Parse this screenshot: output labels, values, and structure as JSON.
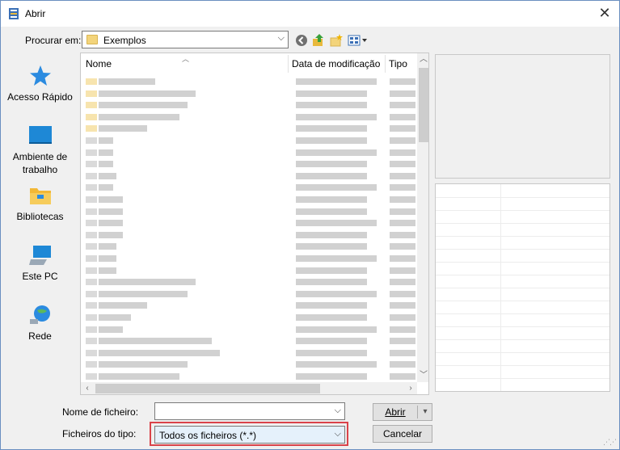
{
  "window": {
    "title": "Abrir"
  },
  "lookin": {
    "label": "Procurar em:",
    "folder": "Exemplos"
  },
  "places": [
    {
      "label": "Acesso Rápido",
      "icon": "star-icon"
    },
    {
      "label": "Ambiente de trabalho",
      "icon": "desktop-icon"
    },
    {
      "label": "Bibliotecas",
      "icon": "libraries-folder-icon"
    },
    {
      "label": "Este PC",
      "icon": "computer-icon"
    },
    {
      "label": "Rede",
      "icon": "network-globe-icon"
    }
  ],
  "filelist": {
    "columns": [
      "Nome",
      "Data de modificação",
      "Tipo"
    ]
  },
  "filename": {
    "label": "Nome de ficheiro:",
    "value": ""
  },
  "filetype": {
    "label": "Ficheiros do tipo:",
    "value": "Todos os ficheiros (*.*)"
  },
  "buttons": {
    "open": "Abrir",
    "cancel": "Cancelar"
  },
  "colors": {
    "accent_highlight": "#d9434a",
    "selected_combo": "#e5f1fb",
    "folder": "#f3d47b"
  }
}
